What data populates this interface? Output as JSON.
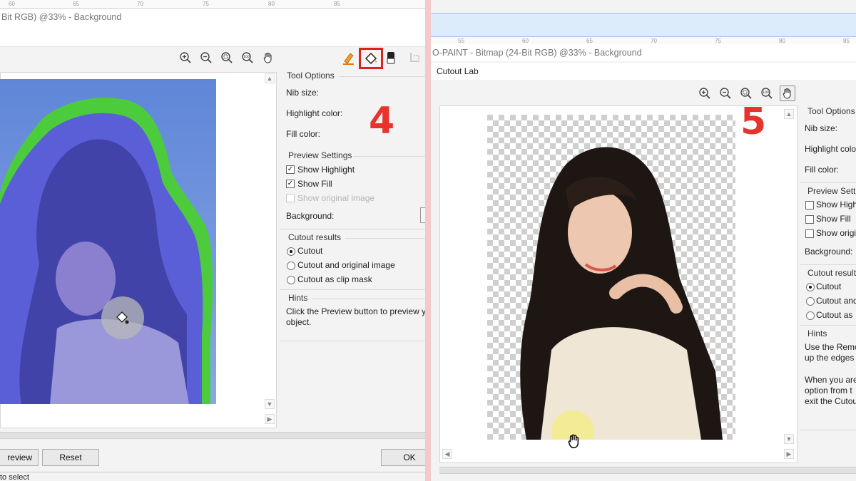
{
  "left": {
    "ruler_ticks": [
      "60",
      "65",
      "70",
      "75",
      "80",
      "85"
    ],
    "title": "Bit RGB) @33% - Background",
    "toolbar_icons": [
      "zoom-in-icon",
      "zoom-out-icon",
      "zoom-fit-icon",
      "zoom-100-icon",
      "pan-hand-icon"
    ],
    "zoom_100_text": "100",
    "tool_options": {
      "title": "Tool Options",
      "nib_size": "Nib size:",
      "highlight_color": "Highlight color:",
      "fill_color": "Fill color:"
    },
    "preview_settings": {
      "title": "Preview Settings",
      "show_highlight": "Show Highlight",
      "show_fill": "Show Fill",
      "show_original": "Show original image",
      "background": "Background:"
    },
    "cutout_results": {
      "title": "Cutout results",
      "cutout": "Cutout",
      "cutout_and_original": "Cutout and original image",
      "cutout_clip_mask": "Cutout as clip mask"
    },
    "hints": {
      "title": "Hints",
      "line1": "Click the Preview button to preview y",
      "line2": "object."
    },
    "buttons": {
      "preview": "review",
      "reset": "Reset",
      "ok": "OK"
    },
    "status": "to select",
    "step": "4",
    "colors": {
      "highlight": "#4ccc3c",
      "fill": "#5a5fd8",
      "step": "#e8322c",
      "focus_box": "#e02020"
    }
  },
  "right": {
    "ruler_ticks": [
      "55",
      "60",
      "65",
      "70",
      "75",
      "80",
      "85"
    ],
    "title": "O-PAINT - Bitmap (24-Bit RGB) @33% - Background",
    "window_title": "Cutout Lab",
    "zoom_100_text": "100",
    "tool_options": {
      "title": "Tool Options",
      "nib_size": "Nib size:",
      "highlight_color": "Highlight colo",
      "fill_color": "Fill color:"
    },
    "preview_settings": {
      "title": "Preview Setti",
      "show_highlight": "Show High",
      "show_fill": "Show Fill",
      "show_original": "Show origi",
      "background": "Background:"
    },
    "cutout_results": {
      "title": "Cutout result",
      "cutout": "Cutout",
      "cutout_and": "Cutout and",
      "cutout_as": "Cutout as"
    },
    "hints": {
      "title": "Hints",
      "lines": [
        "Use the Remo",
        "up the edges",
        "",
        "When you are",
        "option from t",
        "exit the Cutou"
      ]
    },
    "step": "5",
    "colors": {
      "checker_light": "#ffffff",
      "checker_dark": "#cfcfcf",
      "cursor_glow": "#f6ec7a"
    }
  }
}
